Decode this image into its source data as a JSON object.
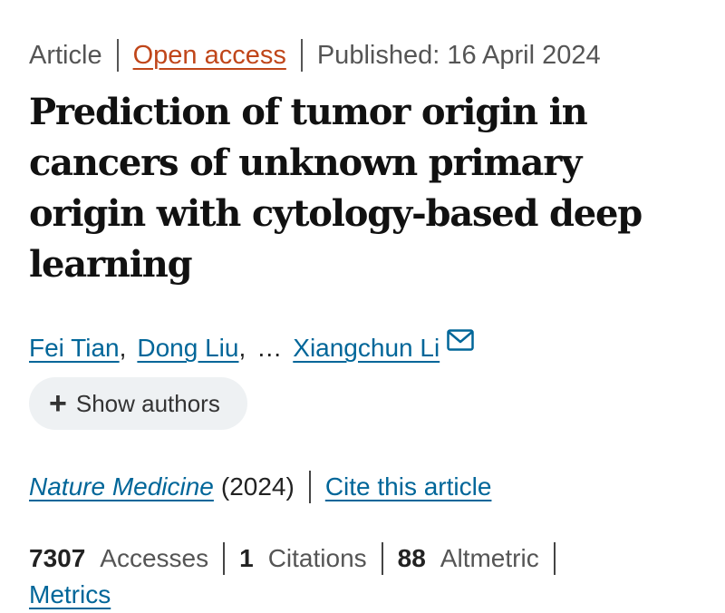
{
  "meta": {
    "type": "Article",
    "access": "Open access",
    "published": "Published: 16 April 2024"
  },
  "title": "Prediction of tumor origin in cancers of unknown primary origin with cytology-based deep learning",
  "authors": {
    "list": [
      "Fei Tian",
      "Dong Liu",
      "Xiangchun Li"
    ],
    "separator": ",",
    "ellipsis": "…",
    "show_authors_label": "Show authors"
  },
  "journal": {
    "name": "Nature Medicine",
    "year": "(2024)",
    "cite_label": "Cite this article"
  },
  "metrics": {
    "accesses_value": "7307",
    "accesses_label": "Accesses",
    "citations_value": "1",
    "citations_label": "Citations",
    "altmetric_value": "88",
    "altmetric_label": "Altmetric",
    "metrics_link": "Metrics"
  },
  "icons": {
    "mail": "mail-icon",
    "plus": "plus-icon"
  },
  "colors": {
    "open_access": "#c0461a",
    "link": "#006699",
    "pill_bg": "#eef1f3"
  }
}
